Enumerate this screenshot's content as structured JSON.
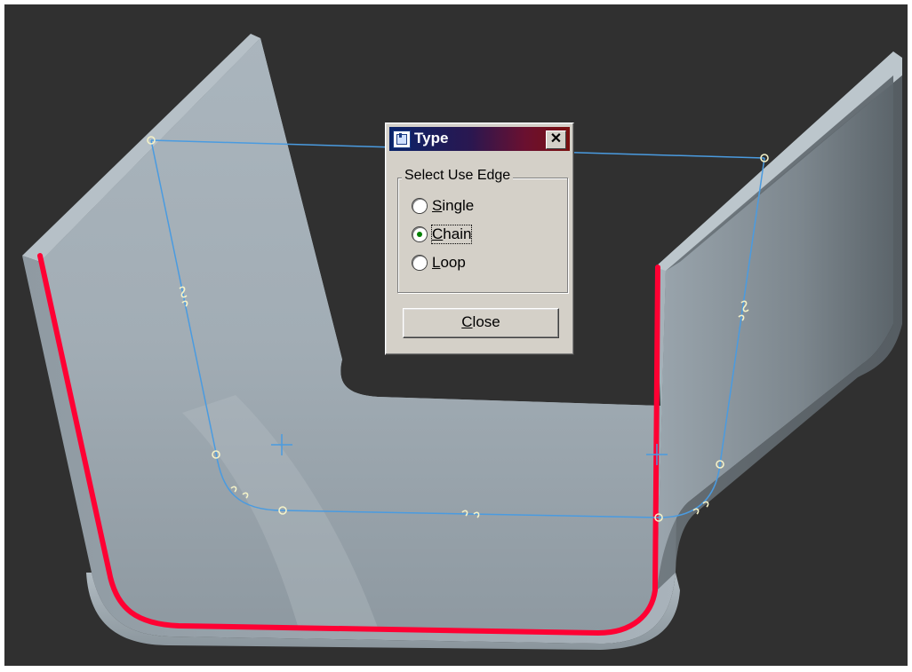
{
  "dialog": {
    "title": "Type",
    "close_glyph": "✕",
    "group_label": "Select Use Edge",
    "options": [
      {
        "label": "Single",
        "mnemonic": "S",
        "rest": "ingle",
        "selected": false
      },
      {
        "label": "Chain",
        "mnemonic": "C",
        "rest": "hain",
        "selected": true
      },
      {
        "label": "Loop",
        "mnemonic": "L",
        "rest": "oop",
        "selected": false
      }
    ],
    "close_button": {
      "label": "Close",
      "mnemonic": "C",
      "rest": "lose"
    }
  },
  "scene": {
    "background_color": "#303030",
    "part_color": "#a6b0b8",
    "highlight_edge_color": "#ff0033",
    "sketch_color": "#4a9be0",
    "vertex_color": "#f4f2c8"
  }
}
